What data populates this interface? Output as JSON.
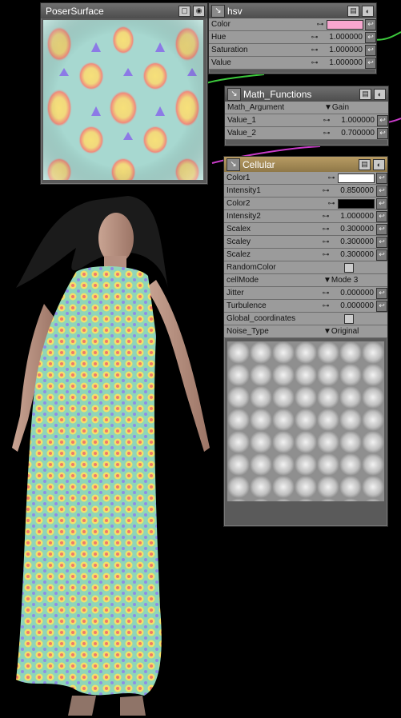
{
  "poser_surface": {
    "title": "PoserSurface"
  },
  "hsv": {
    "title": "hsv",
    "rows": [
      {
        "label": "Color",
        "type": "color",
        "color": "#f7a6cf"
      },
      {
        "label": "Hue",
        "value": "1.000000"
      },
      {
        "label": "Saturation",
        "value": "1.000000"
      },
      {
        "label": "Value",
        "value": "1.000000"
      }
    ]
  },
  "math": {
    "title": "Math_Functions",
    "rows": [
      {
        "label": "Math_Argument",
        "type": "dropdown",
        "value": "Gain"
      },
      {
        "label": "Value_1",
        "value": "1.000000"
      },
      {
        "label": "Value_2",
        "value": "0.700000"
      }
    ]
  },
  "cellular": {
    "title": "Cellular",
    "rows": [
      {
        "label": "Color1",
        "type": "color",
        "color": "#ffffff"
      },
      {
        "label": "Intensity1",
        "value": "0.850000"
      },
      {
        "label": "Color2",
        "type": "color",
        "color": "#000000"
      },
      {
        "label": "Intensity2",
        "value": "1.000000"
      },
      {
        "label": "Scalex",
        "value": "0.300000"
      },
      {
        "label": "Scaley",
        "value": "0.300000"
      },
      {
        "label": "Scalez",
        "value": "0.300000"
      },
      {
        "label": "RandomColor",
        "type": "checkbox"
      },
      {
        "label": "cellMode",
        "type": "dropdown",
        "value": "Mode 3"
      },
      {
        "label": "Jitter",
        "value": "0.000000"
      },
      {
        "label": "Turbulence",
        "value": "0.000000"
      },
      {
        "label": "Global_coordinates",
        "type": "checkbox"
      },
      {
        "label": "Noise_Type",
        "type": "dropdown",
        "value": "Original"
      }
    ]
  },
  "colors": {
    "panel_bg": "#5a5a5a",
    "row_bg": "#9b9b9b",
    "cellular_header": "#a08a55",
    "wire_green": "#3cc83c",
    "wire_magenta": "#c83cc8"
  }
}
